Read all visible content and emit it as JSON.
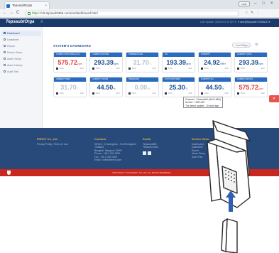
{
  "browser": {
    "tab_title": "Tepsaubtforpk",
    "tab_close": "×",
    "user_label": "User",
    "ctrl_min": "–",
    "ctrl_max": "□",
    "ctrl_close": "×",
    "back": "←",
    "forward": "→",
    "reload": "C",
    "url_secure": "https://",
    "url_rest": "s2.tepsaubt365.com/en/dashboard.html",
    "addr_icons": "☆ ✎ ⋮"
  },
  "header": {
    "logo": "TepsaubtOrga",
    "menu_icon": "≡",
    "status_text": "Last Update: 3/28/2019 11:52:19",
    "user_text": "▾ user@tepsaubt    OSWALD ▾"
  },
  "sidebar": {
    "items": [
      {
        "label": "Dashboard"
      },
      {
        "label": "Datasheet"
      },
      {
        "label": "Report"
      },
      {
        "label": "Device Setup"
      },
      {
        "label": "Alarm Setup"
      },
      {
        "label": "Alarm History"
      },
      {
        "label": "Audit Trail"
      }
    ]
  },
  "main": {
    "title": "SYSTEM'S DASHBOARD",
    "add_widget": "+ Add Widget",
    "gear": "⚙",
    "fab": "✕",
    "tooltip_lines": [
      "Channel : Channel#2 (AIN1-MIN)",
      "Device : HDR-A07",
      "The latest update : 10 secs ago"
    ]
  },
  "cards": [
    {
      "title": "CARBON MONOXIDE (CO)",
      "value": "575.72",
      "unit": "ppm",
      "color": "#e23a3a",
      "foot_left": "DCG",
      "foot_right": "4min"
    },
    {
      "title": "CARBON DIOXIDE",
      "value": "293.39",
      "unit": "ppm",
      "color": "#1e4e92",
      "foot_left": "DCG",
      "foot_right": "4min"
    },
    {
      "title": "TEMPERATURE",
      "value": "31.70",
      "unit": "°C",
      "color": "#b8c0cc",
      "foot_left": "DCG",
      "foot_right": "4min"
    },
    {
      "title": "CO",
      "value": "193.39",
      "unit": "ppm",
      "color": "#1e4e92",
      "foot_left": "DCG",
      "foot_right": "4min"
    },
    {
      "title": "HUMIDITY",
      "value": "24.92",
      "unit": "%RH",
      "color": "#1e4e92",
      "foot_left": "DCG",
      "foot_right": "4min"
    },
    {
      "title": "HUMIDITY DATA",
      "value": "293.39",
      "unit": "ppm",
      "color": "#1e4e92",
      "foot_left": "DCG",
      "foot_right": "4min"
    },
    {
      "title": "AMBIENT TEMP",
      "value": "31.70",
      "unit": "°C",
      "color": "#b8c0cc",
      "foot_left": "DCG",
      "foot_right": "4min"
    },
    {
      "title": "HUMIDITY ROOM",
      "value": "44.50",
      "unit": "%",
      "color": "#1e4e92",
      "foot_left": "DCG",
      "foot_right": "4min"
    },
    {
      "title": "PRESSURE",
      "value": "0.00",
      "unit": "Pa",
      "color": "#b8c0cc",
      "foot_left": "DCG",
      "foot_right": "4min"
    },
    {
      "title": "OUTDOOR TEMP",
      "value": "25.30",
      "unit": "°C",
      "color": "#1e4e92",
      "foot_left": "DCG",
      "foot_right": "4min"
    },
    {
      "title": "HUMIDITY RH",
      "value": "44.50",
      "unit": "%",
      "color": "#1e4e92",
      "foot_left": "DCG",
      "foot_right": "4min"
    },
    {
      "title": "CARBON MONOX",
      "value": "575.72",
      "unit": "ppm",
      "color": "#e23a3a",
      "foot_left": "DCG",
      "foot_right": "4min"
    }
  ],
  "footer": {
    "col1_head": "ENROY Co., Ltd.",
    "col1_lines": [
      "Privacy Policy  |  Terms of Use"
    ],
    "col2_head": "Contacts",
    "col2_lines": [
      "99/123 , S.Tarangkom - Sol Mhongkum",
      "Thailand",
      "Bangkok, Bangsue 10800",
      "Phone : +66 2 000 0000",
      "Fax : +66 2 000 0000",
      "Email : sales@enroy.com"
    ],
    "col3_head": "Social",
    "col3_lines": [
      "Tepsaubt365",
      "Tepsaubt tools"
    ],
    "col4_head": "Service Menu",
    "col4_lines": [
      "Dashboard",
      "Datasheet",
      "Report",
      "Alarm Setup",
      "Audit Trail"
    ],
    "copyright": "COPYRIGHT © 2019 ENROY CO.,LTD. ALL RIGHTS RESERVED"
  }
}
